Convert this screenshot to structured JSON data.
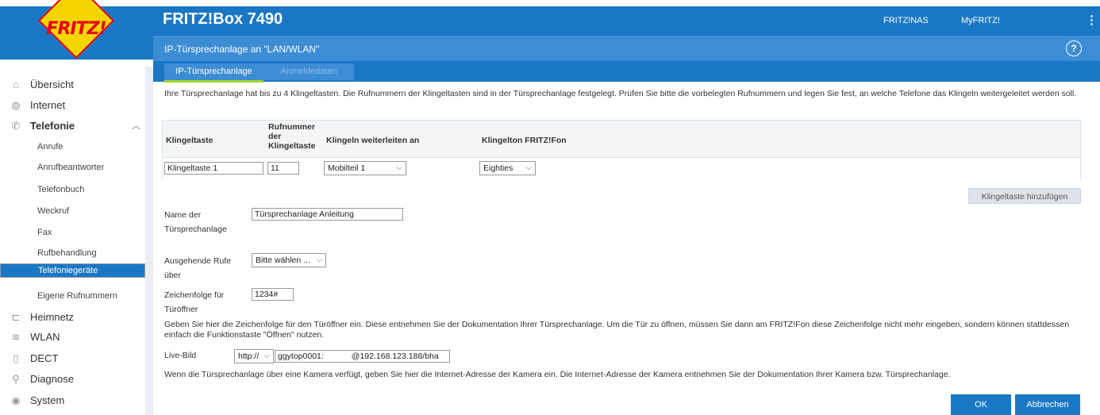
{
  "header": {
    "title": "FRITZ!Box 7490",
    "logo": "FRITZ!",
    "links": [
      "FRITZ!NAS",
      "MyFRITZ!"
    ],
    "menu_icon": "kebab-icon"
  },
  "subheader": {
    "title": "IP-Türsprechanlage an \"LAN/WLAN\"",
    "help": "?"
  },
  "tabs": [
    {
      "label": "IP-Türsprechanlage",
      "active": true
    },
    {
      "label": "Anmeldedaten",
      "active": false
    }
  ],
  "sidebar": {
    "items": [
      {
        "label": "Übersicht",
        "icon": "home-icon"
      },
      {
        "label": "Internet",
        "icon": "globe-icon"
      },
      {
        "label": "Telefonie",
        "icon": "phone-icon",
        "expanded": true
      },
      {
        "label": "Anrufe"
      },
      {
        "label": "Anrufbeantworter"
      },
      {
        "label": "Telefonbuch"
      },
      {
        "label": "Weckruf"
      },
      {
        "label": "Fax"
      },
      {
        "label": "Rufbehandlung"
      },
      {
        "label": "Telefoniegeräte",
        "selected": true
      },
      {
        "label": "Eigene Rufnummern"
      },
      {
        "label": "Heimnetz",
        "icon": "network-icon"
      },
      {
        "label": "WLAN",
        "icon": "wifi-icon"
      },
      {
        "label": "DECT",
        "icon": "dect-icon"
      },
      {
        "label": "Diagnose",
        "icon": "diagnose-icon"
      },
      {
        "label": "System",
        "icon": "system-icon"
      }
    ]
  },
  "main": {
    "intro": "Ihre Türsprechanlage hat bis zu 4 Klingeltasten. Die Rufnummern der Klingeltasten sind in der Türsprechanlage festgelegt. Prüfen Sie bitte die vorbelegten Rufnummern und legen Sie fest, an welche Telefone das Klingeln weitergeleitet werden soll.",
    "table": {
      "headers": [
        "Klingeltaste",
        "Rufnummer der Klingeltaste",
        "Klingeln weiterleiten an",
        "Klingelton FRITZ!Fon"
      ],
      "rows": [
        {
          "name": "Klingeltaste 1",
          "number": "11",
          "forward": "Mobilteil 1",
          "ringtone": "Eighties"
        }
      ]
    },
    "add_button": "Klingeltaste hinzufügen",
    "name_label": "Name der Türsprechanlage",
    "name_value": "Türsprechanlage Anleitung",
    "outgoing_label": "Ausgehende Rufe über",
    "outgoing_value": "Bitte wählen ...",
    "sequence_label": "Zeichenfolge für Türöffner",
    "sequence_value": "1234#",
    "sequence_help": "Geben Sie hier die Zeichenfolge für den Türöffner ein. Diese entnehmen Sie der Dokumentation Ihrer Türsprechanlage. Um die Tür zu öffnen, müssen Sie dann am FRITZ!Fon diese Zeichenfolge nicht mehr eingeben, sondern können stattdessen einfach die Funktionstaste \"Öffnen\" nutzen.",
    "live_label": "Live-Bild",
    "live_protocol": "http://",
    "live_url": "ggytop0001:            @192.168.123.188/bha",
    "live_help": "Wenn die Türsprechanlage über eine Kamera verfügt, geben Sie hier die Internet-Adresse der Kamera ein. Die Internet-Adresse der Kamera entnehmen Sie der Dokumentation Ihrer Kamera bzw. Türsprechanlage."
  },
  "footer": {
    "ok": "OK",
    "cancel": "Abbrechen"
  },
  "colors": {
    "brand_blue": "#1a77c6",
    "light_blue": "#3d8dd5",
    "tab_accent": "#a6d42a"
  }
}
